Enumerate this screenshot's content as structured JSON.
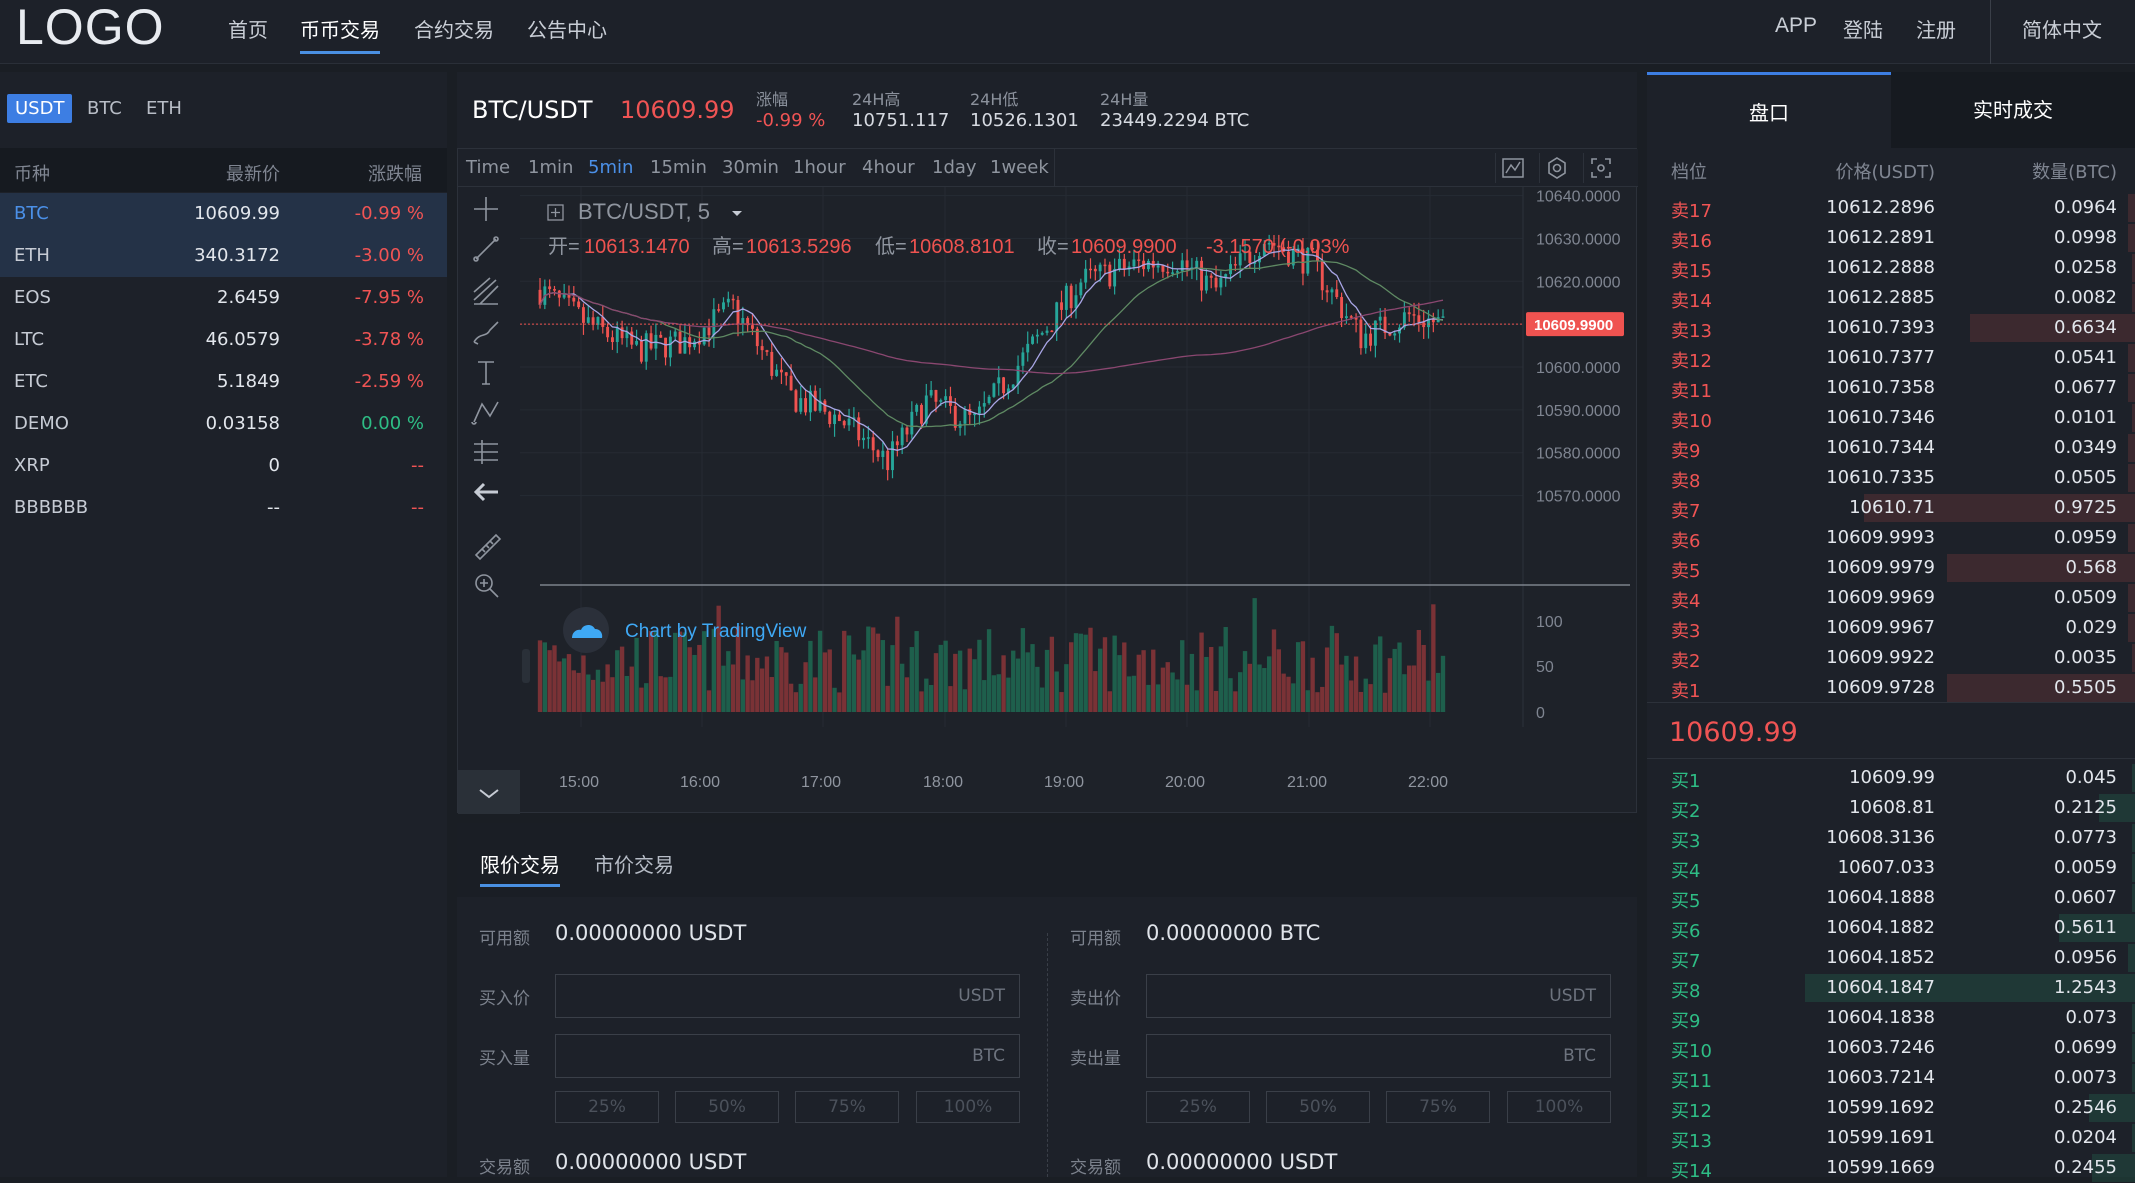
{
  "nav": {
    "logo": "LOGO",
    "items": [
      {
        "label": "首页"
      },
      {
        "label": "币币交易"
      },
      {
        "label": "合约交易"
      },
      {
        "label": "公告中心"
      }
    ],
    "right": {
      "app": "APP",
      "login": "登陆",
      "register": "注册",
      "lang": "简体中文"
    }
  },
  "market": {
    "quote_tabs": [
      "USDT",
      "BTC",
      "ETH"
    ],
    "headers": {
      "coin": "币种",
      "price": "最新价",
      "change": "涨跌幅"
    },
    "rows": [
      {
        "coin": "BTC",
        "price": "10609.99",
        "change": "-0.99 %"
      },
      {
        "coin": "ETH",
        "price": "340.3172",
        "change": "-3.00 %"
      },
      {
        "coin": "EOS",
        "price": "2.6459",
        "change": "-7.95 %"
      },
      {
        "coin": "LTC",
        "price": "46.0579",
        "change": "-3.78 %"
      },
      {
        "coin": "ETC",
        "price": "5.1849",
        "change": "-2.59 %"
      },
      {
        "coin": "DEMO",
        "price": "0.03158",
        "change": "0.00 %"
      },
      {
        "coin": "XRP",
        "price": "0",
        "change": "--"
      },
      {
        "coin": "BBBBBB",
        "price": "--",
        "change": "--"
      }
    ]
  },
  "ticker": {
    "pair": "BTC/USDT",
    "price": "10609.99",
    "change_label": "涨幅",
    "change": "-0.99 %",
    "high_label": "24H高",
    "high": "10751.117",
    "low_label": "24H低",
    "low": "10526.1301",
    "vol_label": "24H量",
    "vol": "23449.2294 BTC"
  },
  "chart": {
    "intervals": [
      "Time",
      "1min",
      "5min",
      "15min",
      "30min",
      "1hour",
      "4hour",
      "1day",
      "1week"
    ],
    "active_interval": "5min",
    "symbol_label": "BTC/USDT, 5",
    "ohlc": {
      "o_label": "开=",
      "o": "10613.1470",
      "h_label": "高=",
      "h": "10613.5296",
      "l_label": "低=",
      "l": "10608.8101",
      "c_label": "收=",
      "c": "10609.9900",
      "chg": "-3.1570 (-0.03%"
    },
    "watermark": "Chart by TradingView",
    "price_ticks": [
      "10640.0000",
      "10630.0000",
      "10620.0000",
      "10610.0000",
      "10600.0000",
      "10590.0000",
      "10580.0000",
      "10570.0000"
    ],
    "last_label": "10609.9900",
    "vol_ticks": [
      "100",
      "50",
      "0"
    ],
    "time_ticks": [
      "15:00",
      "16:00",
      "17:00",
      "18:00",
      "19:00",
      "20:00",
      "21:00",
      "22:00"
    ],
    "colors": {
      "up": "#26a69a",
      "down": "#ef5350"
    }
  },
  "chart_data": {
    "type": "candlestick",
    "x_range": [
      "14:35",
      "22:25"
    ],
    "ylim": [
      10565,
      10642
    ],
    "volume_ylim": [
      0,
      120
    ],
    "last_price": 10609.99,
    "note_series": [
      "MA short",
      "MA mid",
      "MA long"
    ]
  },
  "trade": {
    "tabs": [
      "限价交易",
      "市价交易"
    ],
    "buy": {
      "avail_label": "可用额",
      "avail": "0.00000000 USDT",
      "price_label": "买入价",
      "price_unit": "USDT",
      "qty_label": "买入量",
      "qty_unit": "BTC",
      "total_label": "交易额",
      "total": "0.00000000 USDT"
    },
    "sell": {
      "avail_label": "可用额",
      "avail": "0.00000000 BTC",
      "price_label": "卖出价",
      "price_unit": "USDT",
      "qty_label": "卖出量",
      "qty_unit": "BTC",
      "total_label": "交易额",
      "total": "0.00000000 USDT"
    },
    "pcts": [
      "25%",
      "50%",
      "75%",
      "100%"
    ]
  },
  "book": {
    "tabs": [
      "盘口",
      "实时成交"
    ],
    "headers": {
      "level": "档位",
      "price": "价格(USDT)",
      "qty": "数量(BTC)"
    },
    "asks": [
      {
        "level": "卖17",
        "price": "10612.2896",
        "qty": "0.0964",
        "depth": 0.02
      },
      {
        "level": "卖16",
        "price": "10612.2891",
        "qty": "0.0998",
        "depth": 0.02
      },
      {
        "level": "卖15",
        "price": "10612.2888",
        "qty": "0.0258",
        "depth": 0.01
      },
      {
        "level": "卖14",
        "price": "10612.2885",
        "qty": "0.0082",
        "depth": 0.01
      },
      {
        "level": "卖13",
        "price": "10610.7393",
        "qty": "0.6634",
        "depth": 0.5
      },
      {
        "level": "卖12",
        "price": "10610.7377",
        "qty": "0.0541",
        "depth": 0.02
      },
      {
        "level": "卖11",
        "price": "10610.7358",
        "qty": "0.0677",
        "depth": 0.02
      },
      {
        "level": "卖10",
        "price": "10610.7346",
        "qty": "0.0101",
        "depth": 0.01
      },
      {
        "level": "卖9",
        "price": "10610.7344",
        "qty": "0.0349",
        "depth": 0.02
      },
      {
        "level": "卖8",
        "price": "10610.7335",
        "qty": "0.0505",
        "depth": 0.02
      },
      {
        "level": "卖7",
        "price": "10610.71",
        "qty": "0.9725",
        "depth": 0.82
      },
      {
        "level": "卖6",
        "price": "10609.9993",
        "qty": "0.0959",
        "depth": 0.02
      },
      {
        "level": "卖5",
        "price": "10609.9979",
        "qty": "0.568",
        "depth": 0.57
      },
      {
        "level": "卖4",
        "price": "10609.9969",
        "qty": "0.0509",
        "depth": 0.02
      },
      {
        "level": "卖3",
        "price": "10609.9967",
        "qty": "0.029",
        "depth": 0.02
      },
      {
        "level": "卖2",
        "price": "10609.9922",
        "qty": "0.0035",
        "depth": 0.01
      },
      {
        "level": "卖1",
        "price": "10609.9728",
        "qty": "0.5505",
        "depth": 0.57
      }
    ],
    "last_price": "10609.99",
    "bids": [
      {
        "level": "买1",
        "price": "10609.99",
        "qty": "0.045",
        "depth": 0.01
      },
      {
        "level": "买2",
        "price": "10608.81",
        "qty": "0.2125",
        "depth": 0.11
      },
      {
        "level": "买3",
        "price": "10608.3136",
        "qty": "0.0773",
        "depth": 0.01
      },
      {
        "level": "买4",
        "price": "10607.033",
        "qty": "0.0059",
        "depth": 0.01
      },
      {
        "level": "买5",
        "price": "10604.1888",
        "qty": "0.0607",
        "depth": 0.01
      },
      {
        "level": "买6",
        "price": "10604.1882",
        "qty": "0.5611",
        "depth": 0.23
      },
      {
        "level": "买7",
        "price": "10604.1852",
        "qty": "0.0956",
        "depth": 0.02
      },
      {
        "level": "买8",
        "price": "10604.1847",
        "qty": "1.2543",
        "depth": 1.0
      },
      {
        "level": "买9",
        "price": "10604.1838",
        "qty": "0.073",
        "depth": 0.01
      },
      {
        "level": "买10",
        "price": "10603.7246",
        "qty": "0.0699",
        "depth": 0.01
      },
      {
        "level": "买11",
        "price": "10603.7214",
        "qty": "0.0073",
        "depth": 0.01
      },
      {
        "level": "买12",
        "price": "10599.1692",
        "qty": "0.2546",
        "depth": 0.14
      },
      {
        "level": "买13",
        "price": "10599.1691",
        "qty": "0.0204",
        "depth": 0.01
      },
      {
        "level": "买14",
        "price": "10599.1669",
        "qty": "0.2455",
        "depth": 0.13
      }
    ]
  }
}
